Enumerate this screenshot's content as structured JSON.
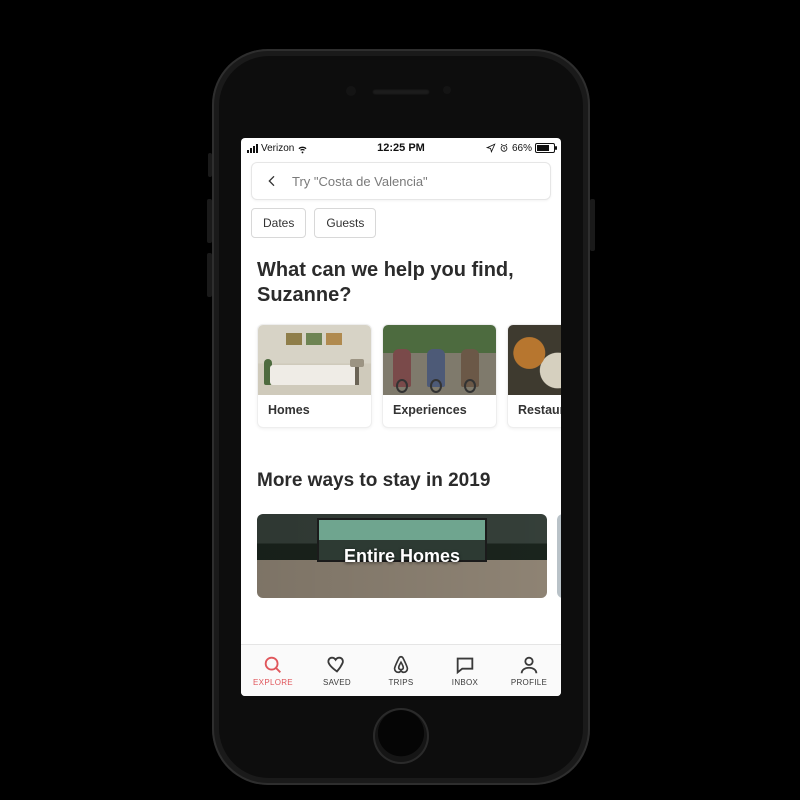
{
  "status": {
    "carrier": "Verizon",
    "time": "12:25 PM",
    "battery_pct": "66%"
  },
  "search": {
    "placeholder": "Try \"Costa de Valencia\""
  },
  "chips": {
    "dates": "Dates",
    "guests": "Guests"
  },
  "headline": "What can we help you find, Suzanne?",
  "categories": [
    {
      "label": "Homes"
    },
    {
      "label": "Experiences"
    },
    {
      "label": "Restaurants"
    }
  ],
  "more_ways_heading": "More ways to stay in 2019",
  "hero": {
    "title": "Entire Homes"
  },
  "tabs": {
    "explore": "EXPLORE",
    "saved": "SAVED",
    "trips": "TRIPS",
    "inbox": "INBOX",
    "profile": "PROFILE"
  },
  "colors": {
    "accent": "#e0565b"
  }
}
